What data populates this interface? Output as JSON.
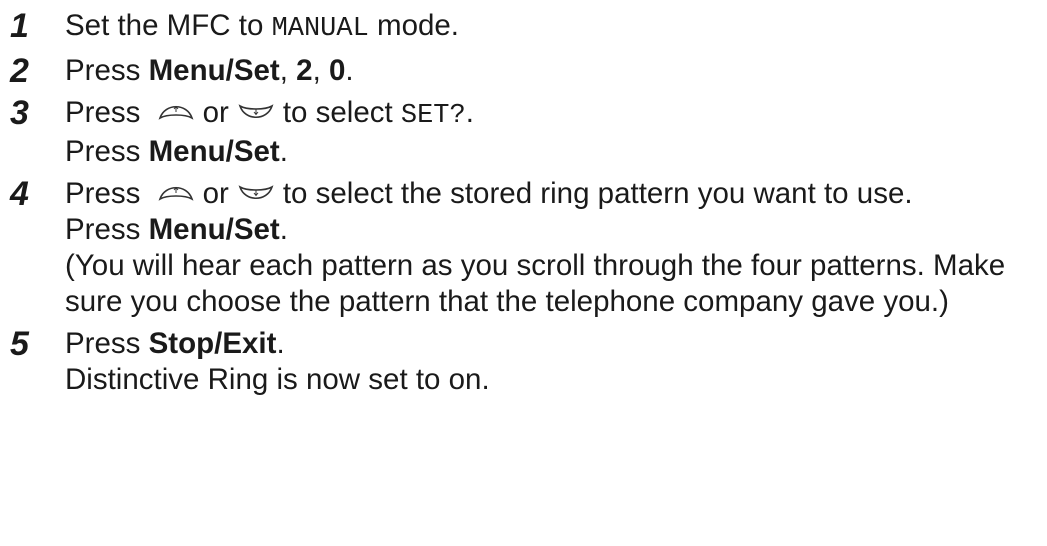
{
  "steps": [
    {
      "number": "1",
      "parts": {
        "a": "Set the MFC to ",
        "code": "MANUAL",
        "b": " mode."
      }
    },
    {
      "number": "2",
      "parts": {
        "a": "Press ",
        "bold1": "Menu/Set",
        "sep1": ", ",
        "bold2": "2",
        "sep2": ", ",
        "bold3": "0",
        "end": "."
      }
    },
    {
      "number": "3",
      "line1": {
        "a": "Press ",
        "or": "or",
        "b": "to select ",
        "code": "SET?",
        "end": "."
      },
      "line2": {
        "a": "Press ",
        "bold": "Menu/Set",
        "end": "."
      }
    },
    {
      "number": "4",
      "line1": {
        "a": "Press ",
        "or": "or",
        "b": "to select the stored ring pattern you want to use."
      },
      "line2": {
        "a": "Press ",
        "bold": "Menu/Set",
        "end": "."
      },
      "line3": "(You will hear each pattern as you scroll through the four patterns. Make sure you choose the pattern that the telephone company gave you.)"
    },
    {
      "number": "5",
      "line1": {
        "a": "Press ",
        "bold": "Stop/Exit",
        "end": "."
      },
      "line2": "Distinctive Ring is now set to on."
    }
  ],
  "icons": {
    "up": "up-arrow-key-icon",
    "down": "down-arrow-key-icon"
  }
}
